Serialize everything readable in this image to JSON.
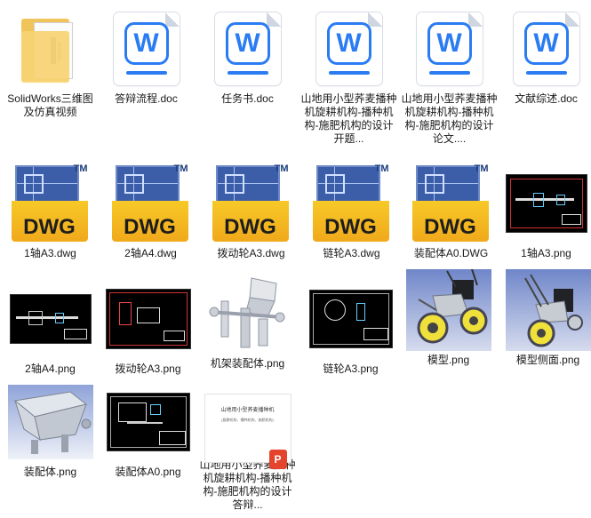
{
  "files": [
    {
      "label": "SolidWorks三维图及仿真视频",
      "kind": "folder",
      "icon": "folder-icon"
    },
    {
      "label": "答辩流程.doc",
      "kind": "doc",
      "icon": "word-document-icon",
      "badge": "W"
    },
    {
      "label": "任务书.doc",
      "kind": "doc",
      "icon": "word-document-icon",
      "badge": "W"
    },
    {
      "label": "山地用小型荞麦播种机旋耕机构-播种机构-施肥机构的设计开题...",
      "kind": "doc",
      "icon": "word-document-icon",
      "badge": "W"
    },
    {
      "label": "山地用小型荞麦播种机旋耕机构-播种机构-施肥机构的设计论文....",
      "kind": "doc",
      "icon": "word-document-icon",
      "badge": "W"
    },
    {
      "label": "文献综述.doc",
      "kind": "doc",
      "icon": "word-document-icon",
      "badge": "W"
    },
    {
      "label": "1轴A3.dwg",
      "kind": "dwg",
      "icon": "dwg-file-icon",
      "badge": "DWG",
      "tm": "TM"
    },
    {
      "label": "2轴A4.dwg",
      "kind": "dwg",
      "icon": "dwg-file-icon",
      "badge": "DWG",
      "tm": "TM"
    },
    {
      "label": "拨动轮A3.dwg",
      "kind": "dwg",
      "icon": "dwg-file-icon",
      "badge": "DWG",
      "tm": "TM"
    },
    {
      "label": "链轮A3.dwg",
      "kind": "dwg",
      "icon": "dwg-file-icon",
      "badge": "DWG",
      "tm": "TM"
    },
    {
      "label": "装配体A0.DWG",
      "kind": "dwg",
      "icon": "dwg-file-icon",
      "badge": "DWG",
      "tm": "TM"
    },
    {
      "label": "1轴A3.png",
      "kind": "cad",
      "icon": "cad-drawing-thumbnail"
    },
    {
      "label": "2轴A4.png",
      "kind": "cad",
      "icon": "cad-drawing-thumbnail"
    },
    {
      "label": "拨动轮A3.png",
      "kind": "cad",
      "icon": "cad-drawing-thumbnail"
    },
    {
      "label": "机架装配体.png",
      "kind": "render",
      "icon": "frame-render-thumbnail"
    },
    {
      "label": "链轮A3.png",
      "kind": "cad",
      "icon": "cad-drawing-thumbnail"
    },
    {
      "label": "模型.png",
      "kind": "render",
      "icon": "model-render-thumbnail"
    },
    {
      "label": "模型侧面.png",
      "kind": "render",
      "icon": "model-side-render-thumbnail"
    },
    {
      "label": "装配体.png",
      "kind": "render",
      "icon": "hopper-render-thumbnail"
    },
    {
      "label": "装配体A0.png",
      "kind": "cad",
      "icon": "cad-drawing-thumbnail"
    },
    {
      "label": "山地用小型荞麦播种机旋耕机构-播种机构-施肥机构的设计答辩...",
      "kind": "ppt",
      "icon": "powerpoint-file-icon",
      "badge": "P",
      "slide_title": "山地用小型荞麦播种机",
      "slide_sub": "(旋耕机构、播种机构、施肥机构)"
    }
  ]
}
